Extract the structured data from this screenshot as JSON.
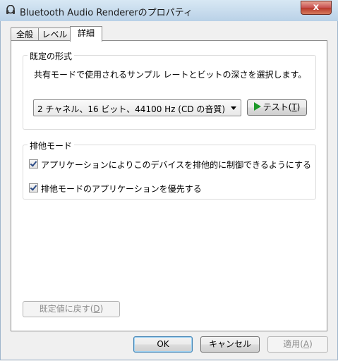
{
  "window": {
    "title": "Bluetooth Audio Rendererのプロパティ",
    "close_label": "x"
  },
  "tabs": [
    {
      "label": "全般"
    },
    {
      "label": "レベル"
    },
    {
      "label": "詳細"
    }
  ],
  "default_format": {
    "group_title": "既定の形式",
    "description": "共有モードで使用されるサンプル レートとビットの深さを選択します。",
    "selected_format": "2 チャネル、16 ビット、44100 Hz (CD の音質)",
    "test_button": {
      "label": "テスト(",
      "accel": "T",
      "suffix": ")"
    }
  },
  "exclusive_mode": {
    "group_title": "排他モード",
    "allow_exclusive": {
      "label": "アプリケーションによりこのデバイスを排他的に制御できるようにする",
      "checked": true
    },
    "give_priority": {
      "label": "排他モードのアプリケーションを優先する",
      "checked": true
    }
  },
  "restore_defaults": {
    "label": "既定値に戻す(",
    "accel": "D",
    "suffix": ")"
  },
  "footer": {
    "ok_label": "OK",
    "cancel_label": "キャンセル",
    "apply": {
      "label": "適用(",
      "accel": "A",
      "suffix": ")"
    }
  }
}
